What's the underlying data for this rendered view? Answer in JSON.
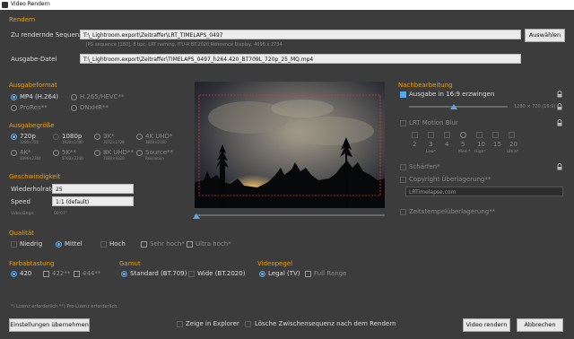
{
  "window": {
    "title": "Video Rendern"
  },
  "render": {
    "section_label": "Rendern",
    "sequence_label": "Zu rendernde Sequenz",
    "sequence_value": "T:\\_Lightroom.export\\Zeitraffer\\LRT_TIMELAPS_0497",
    "select_button": "Auswählen",
    "sequence_info": "JPG sequence [180], 8 bpc, LRT naming, ITU-R BT.2020 Reference Display, 4096 x 2734",
    "output_label": "Ausgabe-Datei",
    "output_value": "T:\\_Lightroom.export\\Zeitraffer\\TIMELAPS_0497_h264.420_BT709L_720p_25_MQ.mp4"
  },
  "format": {
    "section_label": "Ausgabeformat",
    "options": [
      {
        "label": "MP4 (H.264)",
        "state": "on"
      },
      {
        "label": "H.265/HEVC**",
        "state": "dim"
      },
      {
        "label": "ProRes**",
        "state": "dim"
      },
      {
        "label": "DNxHR**",
        "state": "dim"
      }
    ]
  },
  "size": {
    "section_label": "Ausgabegröße",
    "options": [
      {
        "label": "720p",
        "sub": "1280×720",
        "state": "on"
      },
      {
        "label": "1080p",
        "sub": "1920×1080",
        "state": "off"
      },
      {
        "label": "3K*",
        "sub": "3072×1728",
        "state": "dim"
      },
      {
        "label": "4K UHD*",
        "sub": "3840×2160",
        "state": "dim"
      },
      {
        "label": "4K*",
        "sub": "4096×2304",
        "state": "dim"
      },
      {
        "label": "5K**",
        "sub": "5760×3240",
        "state": "dim"
      },
      {
        "label": "8K UHD**",
        "sub": "7680×4320",
        "state": "dim"
      },
      {
        "label": "Source**",
        "sub": "Resolution",
        "state": "dim"
      }
    ]
  },
  "speed": {
    "section_label": "Geschwindigkeit",
    "repeat_label": "Wiederholrate",
    "repeat_value": "25",
    "speed_label": "Speed",
    "speed_value": "1:1 (default)",
    "length_label": "Videolänge:",
    "length_value": "00'07\""
  },
  "quality": {
    "section_label": "Qualität",
    "options": [
      {
        "label": "Niedrig",
        "kind": "check",
        "state": "off"
      },
      {
        "label": "Mittel",
        "kind": "radio",
        "state": "on"
      },
      {
        "label": "Hoch",
        "kind": "check",
        "state": "off"
      },
      {
        "label": "Sehr hoch*",
        "kind": "check",
        "state": "dim"
      },
      {
        "label": "Ultra hoch*",
        "kind": "check",
        "state": "dim"
      }
    ]
  },
  "sampling": {
    "section_label": "Farbabtastung",
    "options": [
      {
        "label": "420",
        "state": "on"
      },
      {
        "label": "422**",
        "state": "dim"
      },
      {
        "label": "444**",
        "state": "dim"
      }
    ]
  },
  "gamut": {
    "section_label": "Gamut",
    "options": [
      {
        "label": "Standard (BT.709)",
        "state": "on"
      },
      {
        "label": "Wide (BT.2020)",
        "state": "off"
      }
    ]
  },
  "levels": {
    "section_label": "Videopegel",
    "options": [
      {
        "label": "Legal (TV)",
        "state": "on"
      },
      {
        "label": "Full Range",
        "state": "dim"
      }
    ]
  },
  "post": {
    "section_label": "Nachbearbeitung",
    "force_169_label": "Ausgabe in 16:9 erzwingen",
    "force_169_readout": "1280 × 720 (16:9)",
    "force_169_slider_fraction": 0.45,
    "motion_blur_label": "LRT Motion Blur",
    "blur_values": [
      "2",
      "3",
      "4",
      "5",
      "10",
      "15",
      "20"
    ],
    "blur_captions": [
      "",
      "Low*",
      "",
      "Med *",
      "High*",
      "",
      "Ultra*"
    ],
    "sharpen_label": "Schärfen*",
    "copyright_label": "Copyright Überlagerung**",
    "copyright_placeholder": "LRTimelapse.com",
    "timestamp_label": "Zeitstempelüberlagerung**"
  },
  "footer": {
    "note": "*) Lizenz erforderlich **) Pro-Lizenz erforderlich.",
    "apply_button": "Einstellungen übernehmen",
    "explorer_label": "Zeige in Explorer",
    "delete_label": "Lösche Zwischensequenz nach dem Rendern",
    "render_button": "Video rendern",
    "cancel_button": "Abbrechen"
  },
  "colors": {
    "accent": "#59a7e8",
    "section": "#f0a000",
    "background": "#3c3c3c"
  },
  "icons": [
    "app-icon",
    "lock-icon",
    "play-head-icon"
  ]
}
